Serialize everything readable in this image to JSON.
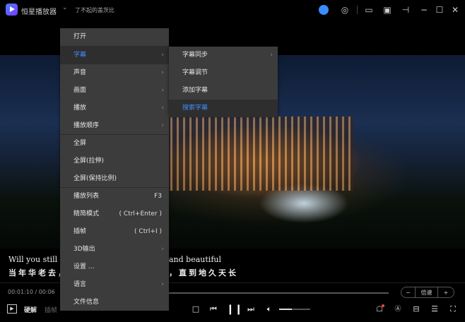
{
  "app": {
    "title": "恒星播放器",
    "dropdown": "⌄",
    "video_title": "了不起的盖茨比"
  },
  "video": {
    "subtitle_en_left": "Will you still lo",
    "subtitle_en_right": "and beautiful",
    "subtitle_zh_left": "当年华老去，",
    "subtitle_zh_right": "，直到地久天长"
  },
  "playback": {
    "time": "00:01:10 / 00:06",
    "speed_label": "倍速",
    "speed_minus": "−",
    "speed_plus": "+",
    "volume": 0.4,
    "hw_decode": "硬解",
    "frame_interp": "插帧"
  },
  "menu": {
    "items": [
      {
        "label": "打开"
      },
      {
        "label": "字幕",
        "submenu": true
      },
      {
        "label": "声音",
        "submenu": true
      },
      {
        "label": "画面",
        "submenu": true
      },
      {
        "label": "播放",
        "submenu": true
      },
      {
        "label": "播放顺序",
        "submenu": true
      },
      {
        "label": "全屏"
      },
      {
        "label": "全屏(拉伸)"
      },
      {
        "label": "全屏(保持比例)"
      },
      {
        "label": "播放列表",
        "shortcut": "F3"
      },
      {
        "label": "精简模式",
        "shortcut": "( Ctrl+Enter )"
      },
      {
        "label": "插帧",
        "shortcut": "( Ctrl+I )"
      },
      {
        "label": "3D输出",
        "submenu": true
      },
      {
        "label": "设置 ..."
      },
      {
        "label": "语言",
        "submenu": true
      },
      {
        "label": "文件信息"
      }
    ]
  },
  "submenu": {
    "items": [
      {
        "label": "字幕同步"
      },
      {
        "label": "字幕调节"
      },
      {
        "label": "添加字幕"
      },
      {
        "label": "搜索字幕"
      }
    ]
  },
  "colors": {
    "accent": "#3d8eff",
    "menu_bg": "#3c3c3c"
  }
}
